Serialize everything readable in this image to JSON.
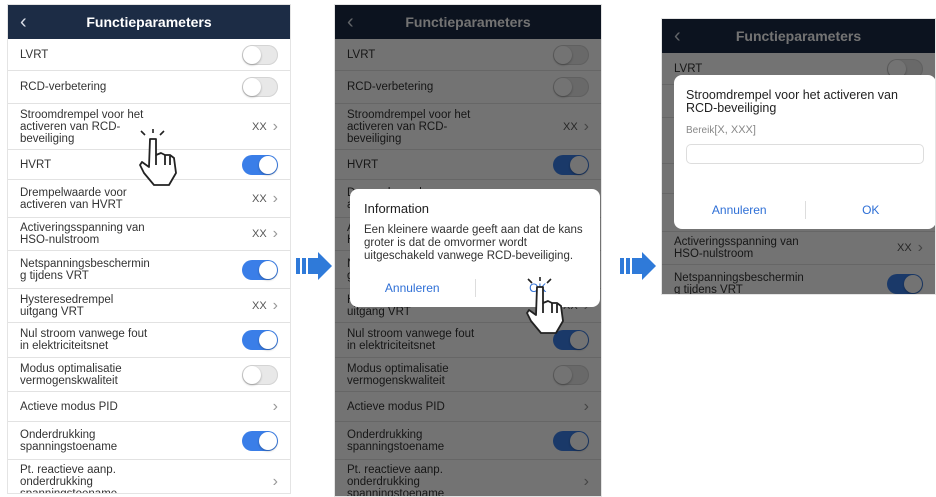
{
  "title": "Functieparameters",
  "back_icon": "chevron-left-icon",
  "settings": [
    {
      "label": "LVRT",
      "control": "toggle",
      "state": "off"
    },
    {
      "label": "RCD-verbetering",
      "control": "toggle",
      "state": "off"
    },
    {
      "label": "Stroomdrempel voor het\nactiveren van RCD-\nbeveiliging",
      "control": "value",
      "value": "XX"
    },
    {
      "label": "HVRT",
      "control": "toggle",
      "state": "on"
    },
    {
      "label": "Drempelwaarde voor\nactiveren van HVRT",
      "control": "value",
      "value": "XX"
    },
    {
      "label": "Activeringsspanning van\nHSO-nulstroom",
      "control": "value",
      "value": "XX"
    },
    {
      "label": "Netspanningsbeschermin\ng tijdens VRT",
      "control": "toggle",
      "state": "on"
    },
    {
      "label": "Hysteresedrempel\nuitgang VRT",
      "control": "value",
      "value": "XX"
    },
    {
      "label": "Nul stroom vanwege fout\nin elektriciteitsnet",
      "control": "toggle",
      "state": "on"
    },
    {
      "label": "Modus optimalisatie\nvermogenskwaliteit",
      "control": "toggle",
      "state": "off"
    },
    {
      "label": "Actieve modus PID",
      "control": "chevron"
    },
    {
      "label": "Onderdrukking\nspanningstoename",
      "control": "toggle",
      "state": "on"
    },
    {
      "label": "Pt. reactieve aanp.\nonderdrukking\nspanningstoename",
      "control": "chevron"
    }
  ],
  "info_dialog": {
    "title": "Information",
    "message": "Een kleinere waarde geeft aan dat de kans groter is dat de omvormer wordt uitgeschakeld vanwege RCD-beveiliging.",
    "cancel_label": "Annuleren",
    "ok_label": "OK"
  },
  "input_dialog": {
    "title": "Stroomdrempel voor het activeren van RCD-beveiliging",
    "range_prefix": "Bereik",
    "range_value": "[X, XXX]",
    "input_value": "",
    "cancel_label": "Annuleren",
    "ok_label": "OK"
  },
  "colors": {
    "header": "#1c2c45",
    "toggle_on": "#3a7ee8",
    "transition_arrow": "#2f7ad9",
    "dialog_button": "#2e6fd6"
  },
  "icons": {
    "transition": "double-arrow-right-icon",
    "tap": "tapping-hand-icon",
    "value_chevron": "chevron-right-icon"
  }
}
